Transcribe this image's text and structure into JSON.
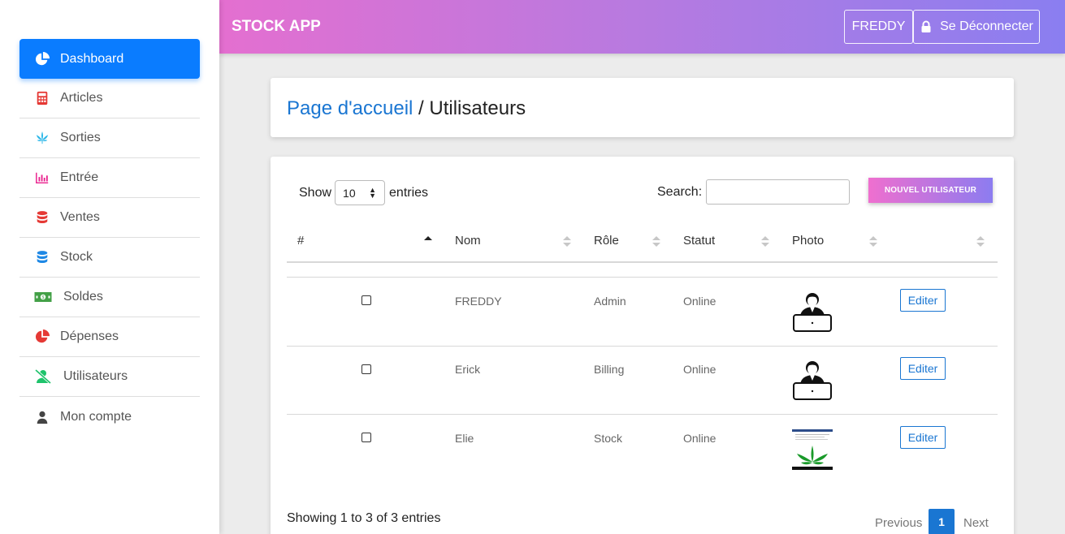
{
  "header": {
    "app_title": "STOCK APP",
    "user_label": "FREDDY",
    "logout_label": "Se Déconnecter"
  },
  "sidebar": {
    "items": [
      {
        "label": "Dashboard",
        "icon": "pie-chart-icon",
        "color": "#ffffff",
        "active": true
      },
      {
        "label": "Articles",
        "icon": "calculator-icon",
        "color": "#e53935"
      },
      {
        "label": "Sorties",
        "icon": "cannabis-leaf-icon",
        "color": "#29b6e8"
      },
      {
        "label": "Entrée",
        "icon": "bar-chart-icon",
        "color": "#e91e8c"
      },
      {
        "label": "Ventes",
        "icon": "database-icon",
        "color": "#e53935"
      },
      {
        "label": "Stock",
        "icon": "database-icon",
        "color": "#1e88e5"
      },
      {
        "label": "Soldes",
        "icon": "money-bill-icon",
        "color": "#43a047"
      },
      {
        "label": "Dépenses",
        "icon": "pie-chart-icon",
        "color": "#e53935"
      },
      {
        "label": "Utilisateurs",
        "icon": "user-slash-icon",
        "color": "#1ec36b"
      },
      {
        "label": "Mon compte",
        "icon": "user-icon",
        "color": "#444444"
      }
    ]
  },
  "breadcrumb": {
    "home": "Page d'accueil",
    "separator": " / ",
    "current": "Utilisateurs"
  },
  "table_controls": {
    "show_label": "Show",
    "entries_value": "10",
    "entries_label": "entries",
    "search_label": "Search:",
    "search_value": "",
    "new_button": "NOUVEL UTILISATEUR"
  },
  "table": {
    "columns": [
      "#",
      "Nom",
      "Rôle",
      "Statut",
      "Photo",
      ""
    ],
    "rows": [
      {
        "name": "FREDDY",
        "role": "Admin",
        "status": "Online",
        "photo": "user-avatar-icon",
        "action": "Editer"
      },
      {
        "name": "Erick",
        "role": "Billing",
        "status": "Online",
        "photo": "user-avatar-icon",
        "action": "Editer"
      },
      {
        "name": "Elie",
        "role": "Stock",
        "status": "Online",
        "photo": "leaf-photo",
        "action": "Editer"
      }
    ]
  },
  "footer": {
    "info": "Showing 1 to 3 of 3 entries",
    "previous": "Previous",
    "page": "1",
    "next": "Next"
  },
  "colors": {
    "primary": "#0a7cff",
    "link": "#1a76d2",
    "header_gradient_start": "#e46fd0",
    "header_gradient_end": "#8a7ef0"
  }
}
